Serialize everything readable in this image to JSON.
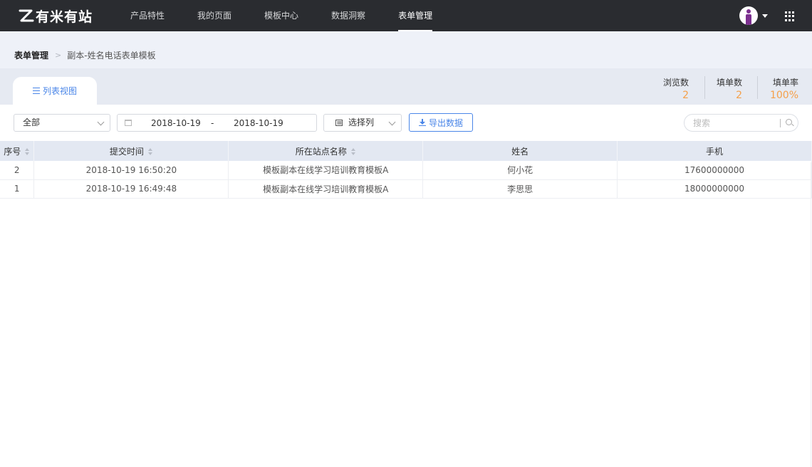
{
  "app": {
    "logo_text": "有米有站"
  },
  "nav": {
    "items": [
      {
        "label": "产品特性"
      },
      {
        "label": "我的页面"
      },
      {
        "label": "模板中心"
      },
      {
        "label": "数据洞察"
      },
      {
        "label": "表单管理"
      }
    ],
    "active_index": 4
  },
  "breadcrumb": {
    "root": "表单管理",
    "separator": ">",
    "current": "副本-姓名电话表单模板"
  },
  "tabs": [
    {
      "label": "列表视图"
    }
  ],
  "stats": [
    {
      "label": "浏览数",
      "value": "2"
    },
    {
      "label": "填单数",
      "value": "2"
    },
    {
      "label": "填单率",
      "value": "100%"
    }
  ],
  "filters": {
    "scope": "全部",
    "date_start": "2018-10-19",
    "date_separator": "-",
    "date_end": "2018-10-19",
    "column_select": "选择列",
    "export_label": "导出数据",
    "search_placeholder": "搜索"
  },
  "table": {
    "headers": [
      "序号",
      "提交时间",
      "所在站点名称",
      "姓名",
      "手机"
    ],
    "rows": [
      [
        "2",
        "2018-10-19 16:50:20",
        "模板副本在线学习培训教育模板A",
        "何小花",
        "17600000000"
      ],
      [
        "1",
        "2018-10-19 16:49:48",
        "模板副本在线学习培训教育模板A",
        "李思思",
        "18000000000"
      ]
    ]
  },
  "colors": {
    "accent": "#4a86e8",
    "stat_value": "#f5a04a",
    "topbar": "#2a2c30"
  },
  "icons": {
    "logo": "z-logo-icon",
    "avatar": "user-avatar-icon",
    "apps": "grid-apps-icon",
    "list": "list-icon",
    "calendar": "calendar-icon",
    "columns": "columns-icon",
    "download": "download-icon",
    "search": "search-icon"
  }
}
